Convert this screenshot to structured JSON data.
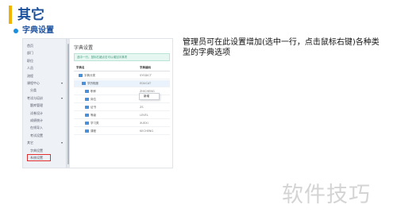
{
  "header": {
    "title": "其它",
    "subtitle": "字典设置"
  },
  "description": "管理员可在此设置增加(选中一行，点击鼠标右键)各种类型的字典选项",
  "watermark": "软件技巧",
  "screenshot": {
    "sidebar": [
      {
        "label": "首页",
        "arrow": "",
        "sub": false
      },
      {
        "label": "部门",
        "arrow": "",
        "sub": false
      },
      {
        "label": "职位",
        "arrow": "",
        "sub": false
      },
      {
        "label": "人员",
        "arrow": "",
        "sub": false
      },
      {
        "label": "流程",
        "arrow": "",
        "sub": false
      },
      {
        "label": "课程中心",
        "arrow": "▾",
        "sub": false
      },
      {
        "label": "分类",
        "arrow": "",
        "sub": true
      },
      {
        "label": "考试与培训",
        "arrow": "▾",
        "sub": false
      },
      {
        "label": "题库管理",
        "arrow": "",
        "sub": true
      },
      {
        "label": "试卷设计",
        "arrow": "",
        "sub": true
      },
      {
        "label": "成绩统计",
        "arrow": "",
        "sub": true
      },
      {
        "label": "在线导入",
        "arrow": "",
        "sub": true
      },
      {
        "label": "考试设置",
        "arrow": "",
        "sub": true
      },
      {
        "label": "其它",
        "arrow": "▾",
        "sub": false
      },
      {
        "label": "字典设置",
        "arrow": "",
        "sub": true
      },
      {
        "label": "系统设置",
        "arrow": "",
        "sub": true
      }
    ],
    "panel_title": "字典设置",
    "tip": "选中一行，鼠标右键点击可以增加字典项",
    "columns": [
      "字典名",
      "字典编码"
    ],
    "rows": [
      {
        "name": "字典分类",
        "code": "SYSDICT"
      },
      {
        "name": "学历程度",
        "code": "EDUCAT"
      },
      {
        "name": "职称",
        "code": "ZHICHENG"
      },
      {
        "name": "岗位",
        "code": "GANGWEI"
      },
      {
        "name": "证书",
        "code": "ZS"
      },
      {
        "name": "等级",
        "code": "LEVEL"
      },
      {
        "name": "学习类",
        "code": "XUEXI"
      },
      {
        "name": "课程",
        "code": "KECHENG"
      }
    ],
    "context_menu": "新增"
  }
}
